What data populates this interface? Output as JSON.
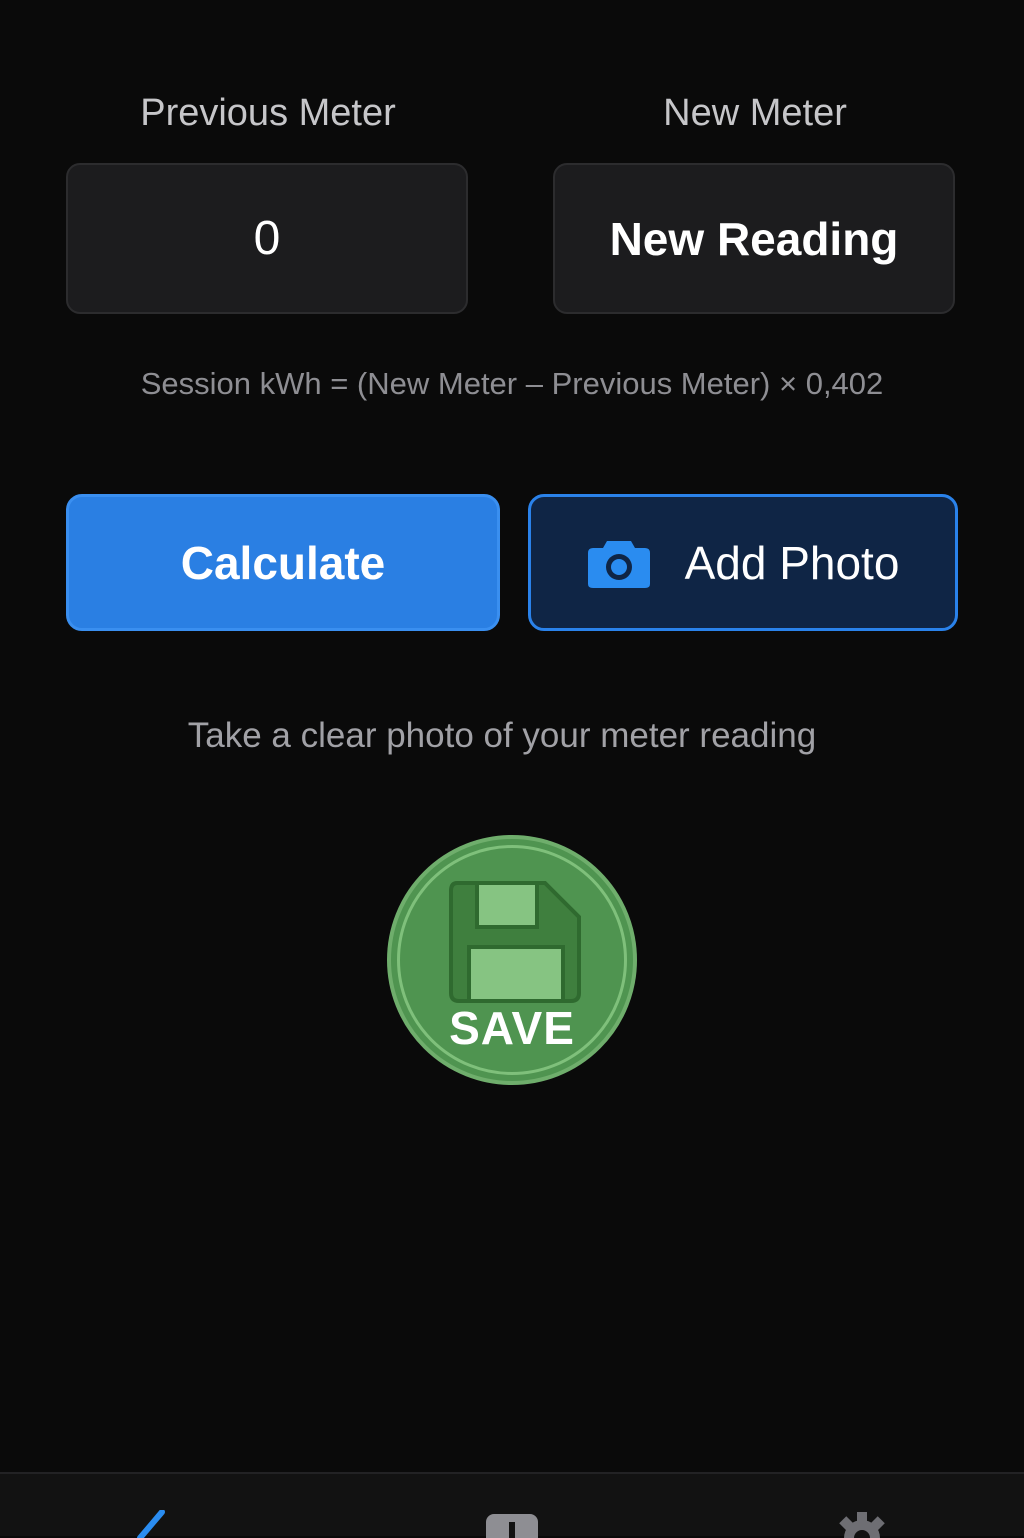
{
  "labels": {
    "previous_meter": "Previous Meter",
    "new_meter": "New Meter"
  },
  "inputs": {
    "previous_value": "0",
    "new_placeholder": "New Reading"
  },
  "formula": "Session kWh = (New Meter – Previous Meter) × 0,402",
  "buttons": {
    "calculate": "Calculate",
    "add_photo": "Add Photo",
    "save": "SAVE"
  },
  "hint": "Take a clear photo of your meter reading",
  "colors": {
    "background": "#0a0a0a",
    "primary_blue": "#2a7fe3",
    "save_green": "#4f9450"
  },
  "tabbar": {
    "icons": [
      "checkmark-icon",
      "document-icon",
      "gear-icon"
    ]
  }
}
